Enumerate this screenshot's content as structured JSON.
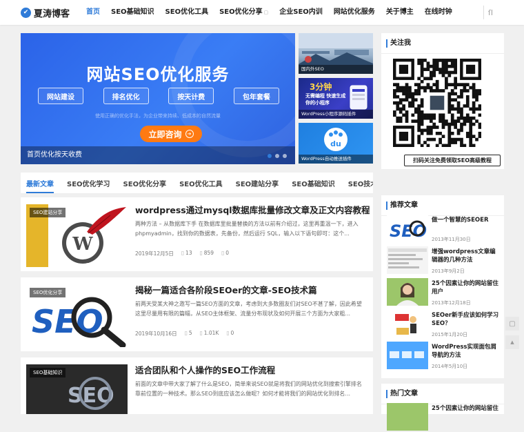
{
  "header": {
    "logo_text": "夏涛博客",
    "nav": [
      {
        "label": "首页",
        "active": true
      },
      {
        "label": "SEO基础知识"
      },
      {
        "label": "SEO优化工具"
      },
      {
        "label": "SEO优化分享",
        "dropdown": true
      },
      {
        "label": "企业SEO内训"
      },
      {
        "label": "网站优化服务"
      },
      {
        "label": "关于博主"
      },
      {
        "label": "在线时钟"
      }
    ],
    "search_icon": "search-icon"
  },
  "banner": {
    "title": "网站SEO优化服务",
    "buttons": [
      "网站建设",
      "排名优化",
      "按天计费",
      "包年套餐"
    ],
    "slogan": "使用正确的优化手法，为企业带来持续、低成本的自然流量",
    "cta": "立即咨询",
    "caption": "首页优化按天收费",
    "active_slide": 1
  },
  "thumbs": [
    {
      "caption": "国内外SEO"
    },
    {
      "caption": "WordPress小程序源码插件",
      "overlay": [
        "3分钟",
        "无需编程 快速生成",
        "你的小程序"
      ]
    },
    {
      "caption": "WordPress自动推送插件"
    }
  ],
  "tabs": [
    "最新文章",
    "SEO优化学习",
    "SEO优化分享",
    "SEO优化工具",
    "SEO建站分享",
    "SEO基础知识",
    "SEO技术文章"
  ],
  "posts": [
    {
      "category": "SEO建站分享",
      "title": "wordpress通过mysql数据库批量修改文章及正文内容教程",
      "excerpt": "两种方法 – 从数据库下手 在数据库里批量替换的方法以前有介绍过，这里再重温一下，进入 phpmyadmin，找到你的数据表，先备份，然后运行 SQL，输入以下语句即可：这个...",
      "date": "2019年12月5日",
      "comments": "13",
      "views": "859",
      "likes": "0"
    },
    {
      "category": "SEO优化分享",
      "title": "揭秘一篇适合各阶段SEOer的文章-SEO技术篇",
      "excerpt": "前两天受某大神之邀写一篇SEO方面的文章，考虑到大多数圈友们对SEO不甚了解，因此希望这里尽量用有限的篇幅，从SEO主体框架、流量分布现状及如何开展三个方面为大家粗...",
      "date": "2019年10月16日",
      "comments": "5",
      "views": "1.01K",
      "likes": "0"
    },
    {
      "category": "SEO基础知识",
      "title": "适合团队和个人操作的SEO工作流程",
      "excerpt": "前面的文章中带大家了解了什么是SEO，简单来说SEO就是将我们的网站优化到搜索引擎排名靠前位置的一种技术。那么SEO到底应该怎么做呢？如何才能将我们的网站优化到排名...",
      "date": "",
      "comments": "",
      "views": "",
      "likes": ""
    }
  ],
  "sidebar": {
    "follow": {
      "title": "关注我",
      "qr_caption": "扫码关注免费领取SEO高级教程"
    },
    "recommended": {
      "title": "推荐文章",
      "items": [
        {
          "title": "做一个智慧的SEOER",
          "date": "2013年11月30日"
        },
        {
          "title": "增强wordpress文章编辑器的几种方法",
          "date": "2013年9月2日"
        },
        {
          "title": "25个因素让你的网站留住用户",
          "date": "2013年12月18日"
        },
        {
          "title": "SEOer新手应该如何学习SEO？",
          "date": "2015年1月20日"
        },
        {
          "title": "WordPress实现面包屑导航的方法",
          "date": "2014年5月10日"
        }
      ]
    },
    "hot": {
      "title": "热门文章",
      "items": [
        {
          "title": "25个因素让你的网站留住"
        }
      ]
    }
  },
  "colors": {
    "accent": "#2f7bd8",
    "cta": "#ff7a12",
    "banner": "#3a7df5"
  }
}
